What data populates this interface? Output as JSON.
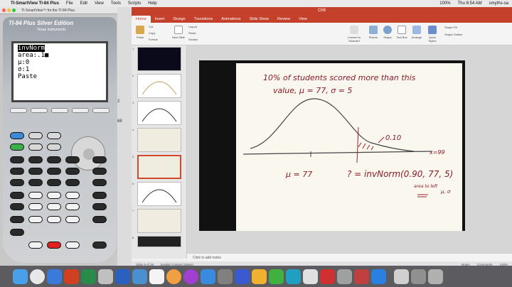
{
  "menubar": {
    "app": "TI-SmartView TI-84 Plus",
    "items": [
      "File",
      "Edit",
      "View",
      "Tools",
      "Scripts",
      "Help"
    ],
    "right_items": [
      "100%",
      "Thu 8:54 AM",
      "smyths-sa"
    ]
  },
  "calc_window": {
    "title": "TI-SmartView™ for the TI-84 Plus"
  },
  "calculator": {
    "model": "TI-84 Plus Silver Edition",
    "brand": "Texas Instruments",
    "screen": {
      "line1": "invNorm",
      "line2": "area:.1■",
      "line3": "μ:0",
      "line4": "σ:1",
      "line5": "Paste"
    }
  },
  "strip": {
    "a": "2",
    "b": "68"
  },
  "ppt": {
    "title": "Ch6",
    "tabs": [
      "Home",
      "Insert",
      "Design",
      "Transitions",
      "Animations",
      "Slide Show",
      "Review",
      "View"
    ],
    "active_tab": "Home",
    "ribbon": {
      "paste": "Paste",
      "cut": "Cut",
      "copy": "Copy",
      "format": "Format",
      "new_slide": "New Slide",
      "layout": "Layout",
      "reset": "Reset",
      "section": "Section",
      "convert": "Convert to SmartArt",
      "picture": "Picture",
      "shape": "Shape",
      "text_box": "Text Box",
      "arrange": "Arrange",
      "quick_styles": "Quick Styles",
      "shape_fill": "Shape Fill",
      "shape_outline": "Shape Outline"
    },
    "slide_numbers": [
      "1",
      "2",
      "3",
      "4",
      "5",
      "6",
      "7",
      "8"
    ],
    "selected_slide": "5",
    "notes": "Click to add notes",
    "status_left": "Slide 5 of 29",
    "status_lang": "English (United States)",
    "status_notes": "Notes",
    "status_comments": "Comments",
    "zoom": "120%"
  },
  "slide_content": {
    "line1": "10% of students scored more than this",
    "line2": "value,  μ = 77,  σ = 5",
    "area_label": "0.10",
    "mu_label": "μ = 77",
    "formula": "? = invNorm(0.90, 77, 5)",
    "note": "area to left",
    "sigma_note": "μ, σ",
    "axis_end": "x=99"
  },
  "colors": {
    "ppt_accent": "#c4402b",
    "ink": "#8a1a2a"
  }
}
